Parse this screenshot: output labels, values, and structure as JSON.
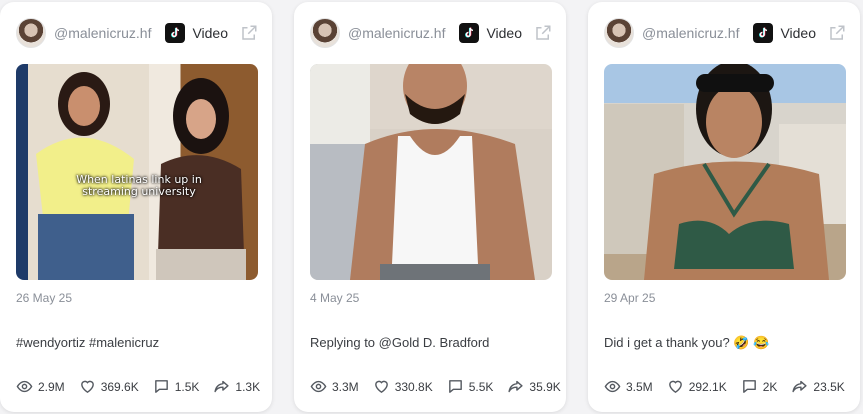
{
  "cards": [
    {
      "username": "@malenicruz.hf",
      "type_label": "Video",
      "overlay_text": "When latinas link up in streaming university",
      "date": "26 May 25",
      "caption": "#wendyortiz #malenicruz",
      "stats": {
        "views": "2.9M",
        "likes": "369.6K",
        "comments": "1.5K",
        "shares": "1.3K"
      }
    },
    {
      "username": "@malenicruz.hf",
      "type_label": "Video",
      "date": "4 May 25",
      "caption": "Replying to @Gold D. Bradford",
      "stats": {
        "views": "3.3M",
        "likes": "330.8K",
        "comments": "5.5K",
        "shares": "35.9K"
      }
    },
    {
      "username": "@malenicruz.hf",
      "type_label": "Video",
      "date": "29 Apr 25",
      "caption": "Did i get a thank you? 🤣 😂",
      "stats": {
        "views": "3.5M",
        "likes": "292.1K",
        "comments": "2K",
        "shares": "23.5K"
      }
    }
  ],
  "icons": {
    "platform": "tiktok-icon",
    "external": "external-link-icon",
    "views": "eye-icon",
    "likes": "heart-icon",
    "comments": "comment-icon",
    "shares": "share-icon"
  },
  "colors": {
    "card_bg": "#ffffff",
    "page_bg": "#f3f3f5",
    "muted_text": "#8a8f98",
    "body_text": "#3a3d42"
  }
}
